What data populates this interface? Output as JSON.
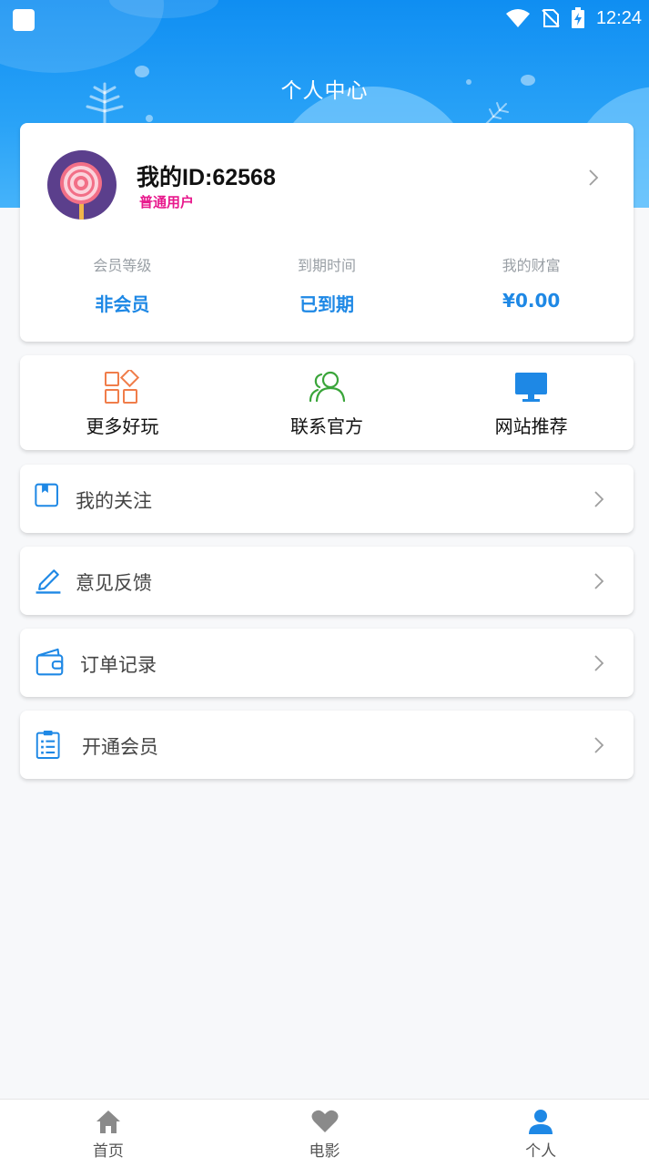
{
  "status": {
    "time": "12:24"
  },
  "header": {
    "title": "个人中心"
  },
  "profile": {
    "id_text": "我的ID:62568",
    "role": "普通用户"
  },
  "stats": [
    {
      "label": "会员等级",
      "value": "非会员"
    },
    {
      "label": "到期时间",
      "value": "已到期"
    },
    {
      "label": "我的财富",
      "value": "¥0.00"
    }
  ],
  "quick": [
    {
      "label": "更多好玩",
      "icon": "apps-grid-icon",
      "color": "#f07d4a"
    },
    {
      "label": "联系官方",
      "icon": "users-icon",
      "color": "#3aa53a"
    },
    {
      "label": "网站推荐",
      "icon": "monitor-icon",
      "color": "#1e88e5"
    }
  ],
  "menu": [
    {
      "label": "我的关注",
      "icon": "bookmark-icon"
    },
    {
      "label": "意见反馈",
      "icon": "edit-icon"
    },
    {
      "label": "订单记录",
      "icon": "wallet-icon"
    },
    {
      "label": "开通会员",
      "icon": "clipboard-list-icon"
    }
  ],
  "tabs": [
    {
      "label": "首页",
      "icon": "home-icon"
    },
    {
      "label": "电影",
      "icon": "heart-icon"
    },
    {
      "label": "个人",
      "icon": "person-icon",
      "active": true
    }
  ],
  "colors": {
    "accent": "#1e88e5",
    "role": "#e8188c",
    "header": "#0f8ef2"
  }
}
